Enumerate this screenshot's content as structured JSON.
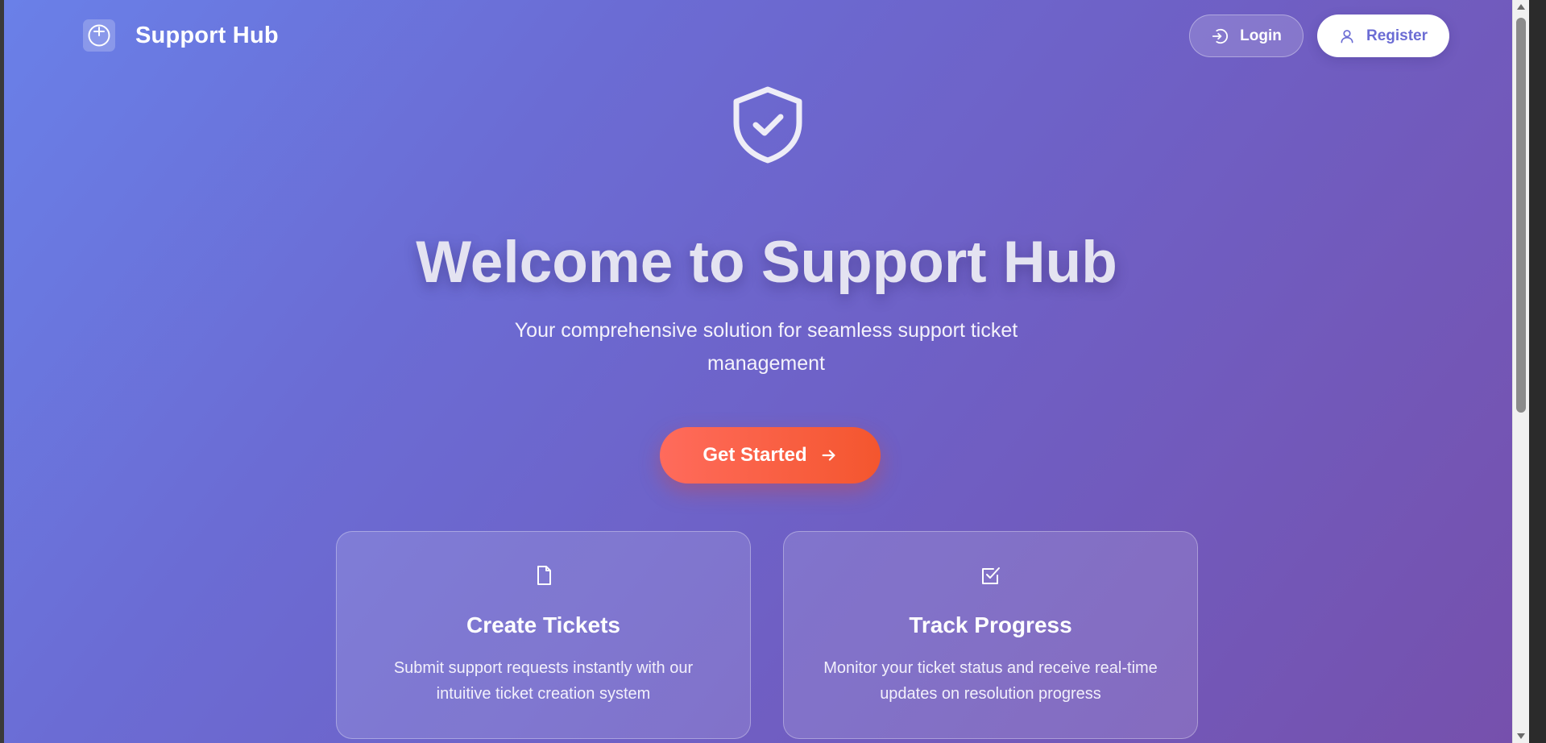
{
  "header": {
    "brand": "Support Hub",
    "login_label": "Login",
    "register_label": "Register"
  },
  "hero": {
    "title": "Welcome to Support Hub",
    "subtitle": "Your comprehensive solution for seamless support ticket management",
    "cta_label": "Get Started"
  },
  "features": [
    {
      "title": "Create Tickets",
      "description": "Submit support requests instantly with our intuitive ticket creation system",
      "icon": "document-icon"
    },
    {
      "title": "Track Progress",
      "description": "Monitor your ticket status and receive real-time updates on resolution progress",
      "icon": "checkbox-icon"
    }
  ],
  "colors": {
    "gradient_start": "#6a80e8",
    "gradient_end": "#7650ac",
    "cta_start": "#ff6b5c",
    "cta_end": "#f4562e",
    "accent": "#6b6cd4"
  }
}
